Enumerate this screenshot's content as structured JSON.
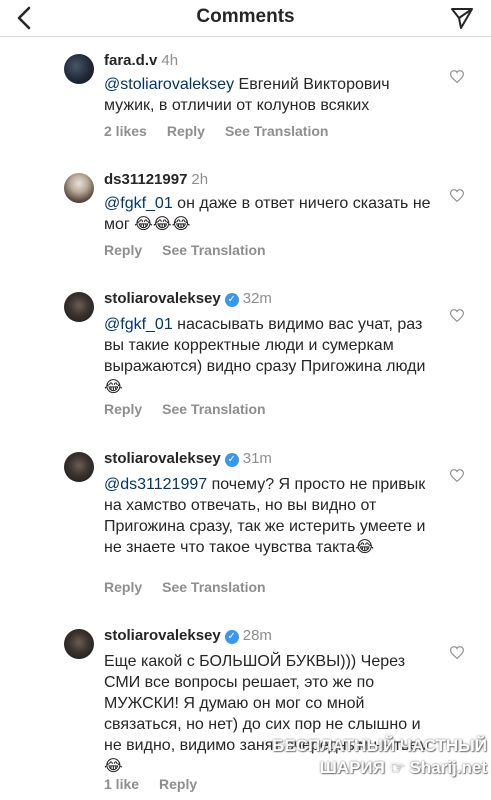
{
  "header": {
    "title": "Comments"
  },
  "comments": [
    {
      "user": "fara.d.v",
      "time": "4h",
      "mention": "@stoliarovaleksey",
      "text": " Евгений Викторович мужик, в отличии от колунов всяких",
      "likes": "2 likes",
      "reply": "Reply",
      "see_translation": "See Translation"
    },
    {
      "user": "ds31121997",
      "time": "2h",
      "mention": "@fgkf_01",
      "text": " он даже в ответ ничего сказать не мог 😂😂😂",
      "reply": "Reply",
      "see_translation": "See Translation"
    },
    {
      "user": "stoliarovaleksey",
      "time": "32m",
      "mention": "@fgkf_01",
      "text": " насасывать видимо вас учат, раз вы такие корректные люди и сумеркам выражаются) видно сразу Пригожина люди 😂",
      "reply": "Reply",
      "see_translation": "See Translation"
    },
    {
      "user": "stoliarovaleksey",
      "time": "31m",
      "mention": "@ds31121997",
      "text": " почему? Я просто не привык на хамство отвечать, но вы видно от Пригожина сразу, так же истерить умеете и не знаете что такое чувства такта😂",
      "reply": "Reply",
      "see_translation": "See Translation"
    },
    {
      "user": "stoliarovaleksey",
      "time": "28m",
      "text": "Еще какой с БОЛЬШОЙ БУКВЫ))) Через СМИ все вопросы решает, это же по МУЖСКИ! Я думаю он мог со мной связаться, но нет) до сих пор не слышно и не видно, видимо занят очередным нытьем😂",
      "likes": "1 like",
      "reply": "Reply"
    }
  ],
  "watermark": {
    "line1": "БЕСПЛАТНЫЙ ЧАСТНЫЙ",
    "line2": "ШАРИЯ ☞ Sharij.net"
  },
  "icons": {
    "back": "chevron-left-icon",
    "send": "direct-send-icon",
    "heart": "heart-outline-icon",
    "verified": "verified-badge-icon"
  },
  "colors": {
    "username": "#262626",
    "muted": "#8e8e8e",
    "mention": "#00376b",
    "verified": "#3897f0"
  }
}
